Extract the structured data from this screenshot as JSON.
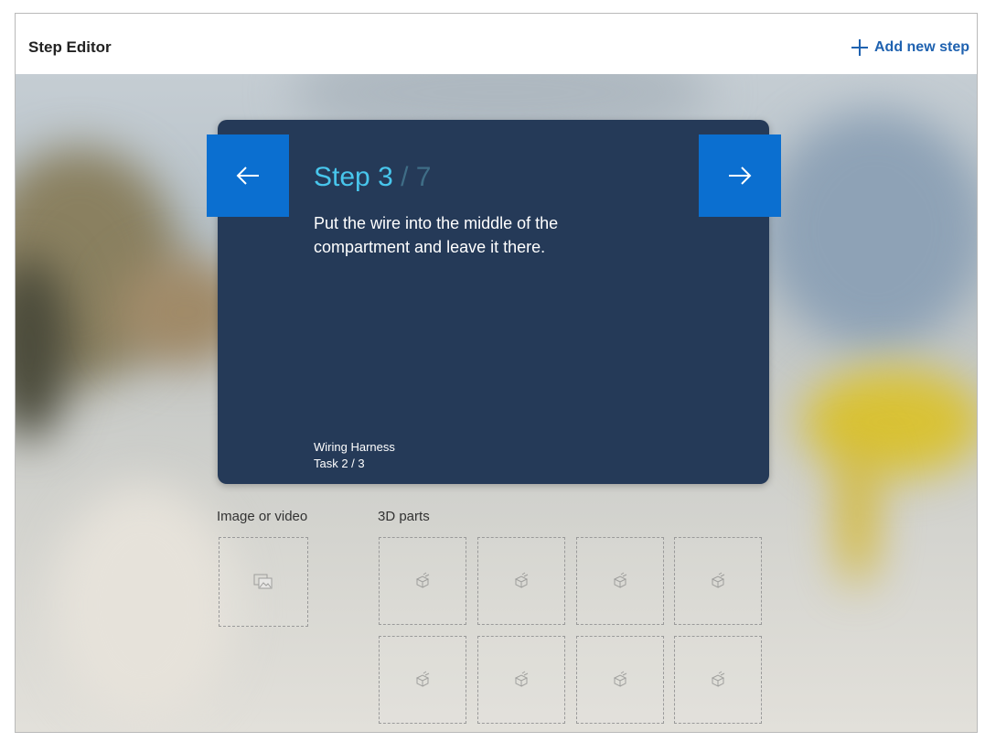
{
  "header": {
    "title": "Step Editor",
    "add_step_label": "Add new step"
  },
  "card": {
    "step_prefix": "Step",
    "current_step": "3",
    "separator": "/",
    "total_steps": "7",
    "instruction": "Put the wire into the middle of the compartment and leave it there.",
    "task_name": "Wiring Harness",
    "task_progress": "Task 2 / 3"
  },
  "media": {
    "image_label": "Image or video",
    "parts_label": "3D parts"
  },
  "icons": {
    "prev": "arrow-left-icon",
    "next": "arrow-right-icon",
    "add": "plus-icon",
    "image": "image-icon",
    "part": "cube-icon"
  },
  "colors": {
    "accent": "#0b6fd0",
    "card_bg": "#253a58",
    "step_highlight": "#48c6ec",
    "link": "#1f62b0"
  }
}
